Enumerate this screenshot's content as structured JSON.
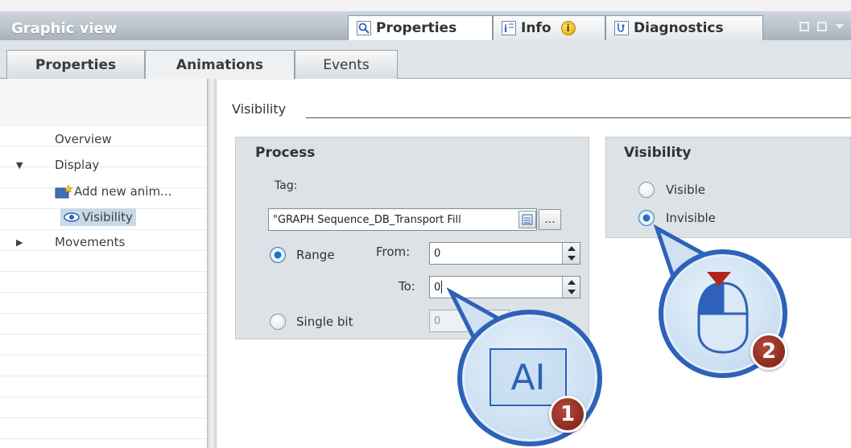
{
  "title_bar": {
    "title": "Graphic view",
    "tabs": [
      {
        "label": "Properties",
        "icon": "magnifier-icon",
        "active": true
      },
      {
        "label": "Info",
        "icon": "info-icon",
        "active": false
      },
      {
        "label": "Diagnostics",
        "icon": "diagnostics-icon",
        "active": false
      }
    ]
  },
  "sub_tabs": [
    {
      "label": "Properties",
      "active": false
    },
    {
      "label": "Animations",
      "active": true
    },
    {
      "label": "Events",
      "active": false
    }
  ],
  "tree": {
    "items": [
      {
        "label": "Overview",
        "expander": "",
        "icon": ""
      },
      {
        "label": "Display",
        "expander": "▼",
        "icon": ""
      },
      {
        "label": "Add new anim...",
        "expander": "",
        "icon": "add-animation-icon"
      },
      {
        "label": "Visibility",
        "expander": "",
        "icon": "eye-icon"
      },
      {
        "label": "Movements",
        "expander": "▶",
        "icon": ""
      }
    ]
  },
  "main": {
    "section_label": "Visibility",
    "process": {
      "title": "Process",
      "tag_label": "Tag:",
      "tag_value": "\"GRAPH Sequence_DB_Transport Fill",
      "browse_label": "...",
      "range_label": "Range",
      "from_label": "From:",
      "from_value": "0",
      "to_label": "To:",
      "to_value": "0",
      "single_bit_label": "Single bit",
      "single_bit_value": "0",
      "selected": "Range"
    },
    "visibility": {
      "title": "Visibility",
      "options": [
        "Visible",
        "Invisible"
      ],
      "selected": "Invisible"
    }
  },
  "callouts": [
    {
      "number": "1",
      "content": "AI"
    },
    {
      "number": "2",
      "content": "mouse-left-click-icon"
    }
  ],
  "colors": {
    "accent_blue": "#2d62b8",
    "badge_red": "#8f2a1d",
    "radio_selected": "#1e74c9"
  }
}
